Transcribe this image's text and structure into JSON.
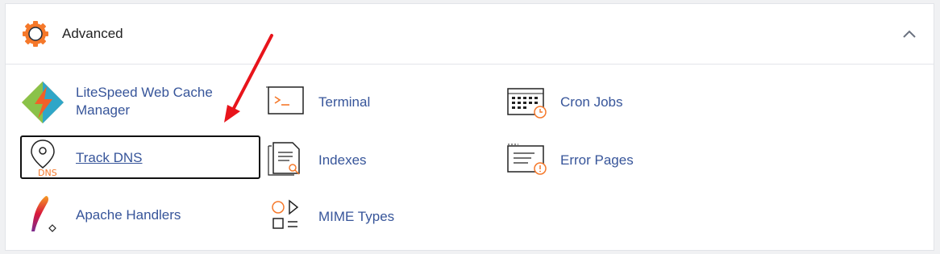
{
  "section": {
    "title": "Advanced",
    "gear_icon": "gear-icon",
    "collapse_icon": "chevron-up-icon"
  },
  "items": [
    {
      "label": "LiteSpeed Web Cache Manager",
      "icon": "litespeed-icon"
    },
    {
      "label": "Terminal",
      "icon": "terminal-icon"
    },
    {
      "label": "Cron Jobs",
      "icon": "calendar-clock-icon"
    },
    {
      "label": "Track DNS",
      "icon": "map-pin-dns-icon"
    },
    {
      "label": "Indexes",
      "icon": "document-search-icon"
    },
    {
      "label": "Error Pages",
      "icon": "error-page-icon"
    },
    {
      "label": "Apache Handlers",
      "icon": "apache-feather-icon"
    },
    {
      "label": "MIME Types",
      "icon": "shapes-icon"
    }
  ],
  "annotation": {
    "icon": "red-arrow-icon",
    "color": "#e8141b"
  },
  "colors": {
    "accent": "#f5782a",
    "link": "#37559a"
  }
}
